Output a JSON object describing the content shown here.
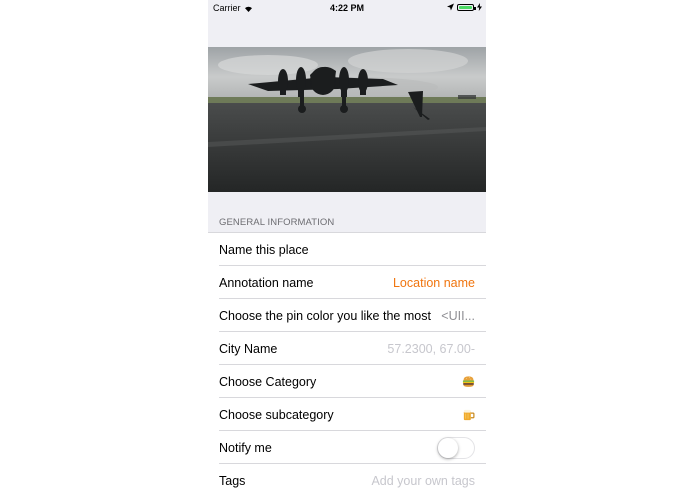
{
  "status_bar": {
    "carrier": "Carrier",
    "time": "4:22 PM",
    "battery_color": "#4cd964"
  },
  "photo": {
    "description_icon": "photo-image"
  },
  "form": {
    "section_header": "GENERAL INFORMATION",
    "rows": [
      {
        "label": "Name this place",
        "value": ""
      },
      {
        "label": "Annotation name",
        "value": "Location name"
      },
      {
        "label": "Choose the pin color you like the most",
        "value": "<UII..."
      },
      {
        "label": "City Name",
        "value": "57.2300, 67.00-"
      },
      {
        "label": "Choose Category",
        "icon": "burger-icon"
      },
      {
        "label": "Choose subcategory",
        "icon": "beer-mug-icon"
      },
      {
        "label": "Notify me",
        "toggle": false
      },
      {
        "label": "Tags",
        "value": "Add your own tags"
      }
    ]
  },
  "colors": {
    "accent": "#f0750f",
    "background": "#efeff4",
    "separator": "#d8d8dc",
    "placeholder": "#c7c7cd",
    "section_text": "#6d6d72"
  }
}
